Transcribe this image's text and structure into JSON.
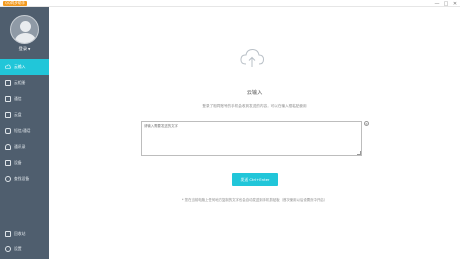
{
  "titlebar": {
    "app_title": "QQ同步助手",
    "minimize": "—",
    "maximize": "□",
    "close": "✕"
  },
  "user": {
    "login_label": "登录",
    "caret": "▼"
  },
  "sidebar": {
    "items": [
      {
        "label": "云输入",
        "icon": "cloud-input-icon"
      },
      {
        "label": "云相册",
        "icon": "photo-album-icon"
      },
      {
        "label": "通信",
        "icon": "contacts-icon"
      },
      {
        "label": "云盘",
        "icon": "cloud-disk-icon"
      },
      {
        "label": "短信/通话",
        "icon": "sms-icon"
      },
      {
        "label": "通讯录",
        "icon": "address-book-icon"
      },
      {
        "label": "设备",
        "icon": "device-icon"
      },
      {
        "label": "查找设备",
        "icon": "find-device-icon"
      }
    ],
    "bottom_items": [
      {
        "label": "回收站",
        "icon": "recycle-bin-icon"
      },
      {
        "label": "设置",
        "icon": "settings-icon"
      }
    ]
  },
  "main": {
    "title": "云输入",
    "description": "登录了相同账号的手机会收到发送的内容，可以在输入框粘贴使用",
    "input_placeholder": "请输入需要发送的文字",
    "send_button": "发送 Ctrl+Enter",
    "note": "* 您在当前电脑上任何地方复制的文字也会自动发送到手机剪贴板（首次使用以后设置页中开启）",
    "clear_label": "×"
  },
  "colors": {
    "accent": "#21c6d9",
    "sidebar": "#4f5e6e",
    "badge": "#f39a1e"
  }
}
